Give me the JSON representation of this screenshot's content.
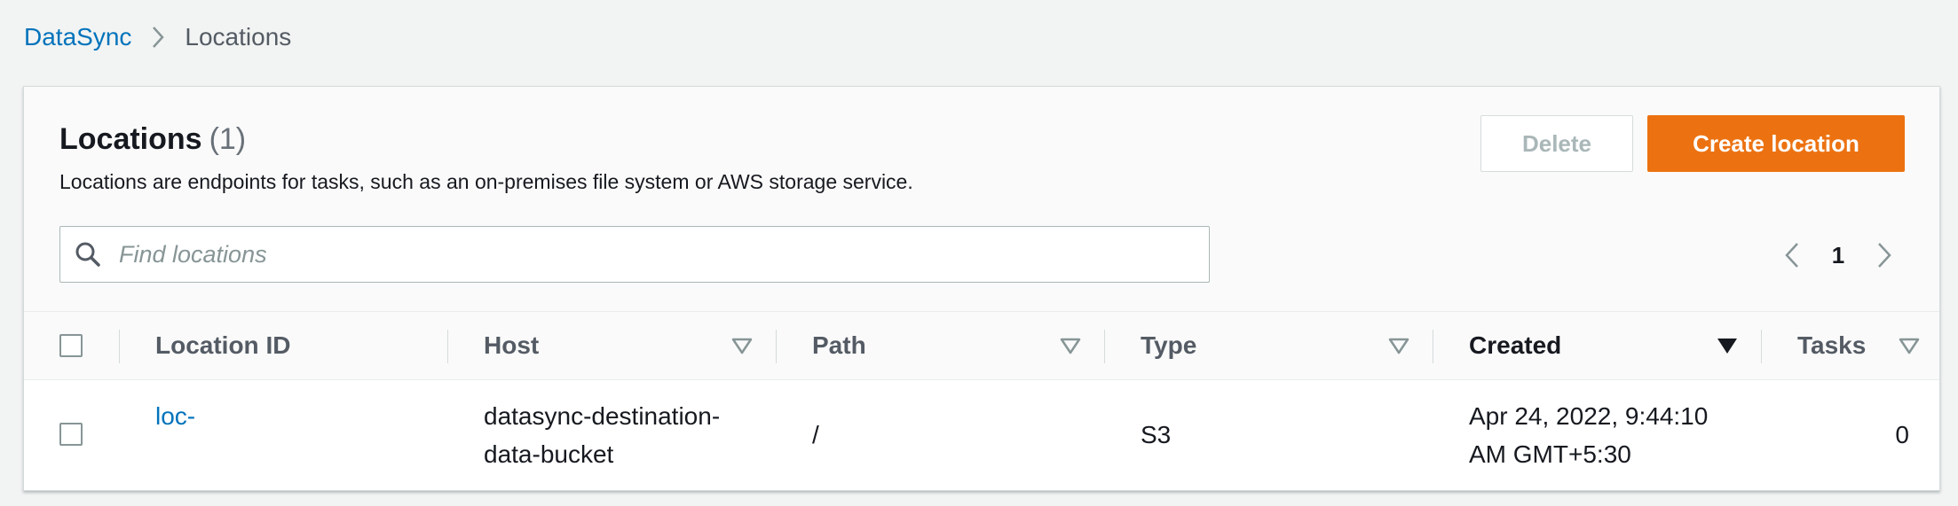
{
  "breadcrumb": {
    "root": "DataSync",
    "current": "Locations"
  },
  "header": {
    "title": "Locations",
    "count": "(1)",
    "description": "Locations are endpoints for tasks, such as an on-premises file system or AWS storage service.",
    "delete_label": "Delete",
    "create_label": "Create location"
  },
  "search": {
    "placeholder": "Find locations",
    "value": ""
  },
  "pagination": {
    "current_page": "1"
  },
  "table": {
    "columns": {
      "location_id": "Location ID",
      "host": "Host",
      "path": "Path",
      "type": "Type",
      "created": "Created",
      "tasks": "Tasks"
    },
    "sorted_column": "created",
    "sort_direction": "descending",
    "rows": [
      {
        "location_id": "loc-",
        "host_line1": "datasync-destination-",
        "host_line2": "data-bucket",
        "path": "/",
        "type": "S3",
        "created_line1": "Apr 24, 2022, 9:44:10",
        "created_line2": "AM GMT+5:30",
        "tasks": "0",
        "selected": false
      }
    ]
  },
  "icons": {
    "breadcrumb_separator": "chevron-right-icon",
    "search": "search-icon",
    "prev_page": "chevron-left-icon",
    "next_page": "chevron-right-icon",
    "sort_inactive": "caret-down-outline-icon",
    "sort_active": "caret-down-filled-icon"
  },
  "colors": {
    "link": "#0073bb",
    "primary_button": "#ec7211",
    "page_background": "#f2f3f3"
  }
}
